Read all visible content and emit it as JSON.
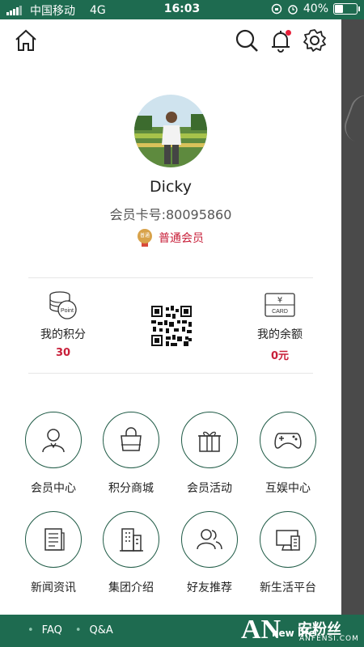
{
  "status_bar": {
    "carrier": "中国移动",
    "network": "4G",
    "time": "16:03",
    "battery": "40%",
    "battery_level": 0.4
  },
  "icons": {
    "home": "home-icon",
    "search": "search-icon",
    "bell": "bell-icon",
    "settings": "gear-icon"
  },
  "profile": {
    "name": "Dicky",
    "card_number": "会员卡号:80095860",
    "level": "普通会员",
    "medal_text": "普通"
  },
  "stats": {
    "points": {
      "label": "我的积分",
      "value": "30",
      "icon_text": "Point"
    },
    "balance": {
      "label": "我的余额",
      "value": "0元",
      "icon_text": "CARD",
      "currency": "¥"
    }
  },
  "menu": [
    {
      "label": "会员中心",
      "icon": "person-icon"
    },
    {
      "label": "积分商城",
      "icon": "shopping-bag-icon"
    },
    {
      "label": "会员活动",
      "icon": "gift-icon"
    },
    {
      "label": "互娱中心",
      "icon": "gamepad-icon"
    },
    {
      "label": "新闻资讯",
      "icon": "news-icon"
    },
    {
      "label": "集团介绍",
      "icon": "building-icon"
    },
    {
      "label": "好友推荐",
      "icon": "friends-icon"
    },
    {
      "label": "新生活平台",
      "icon": "platform-icon"
    }
  ],
  "footer": {
    "faq": "FAQ",
    "qa": "Q&A",
    "brand": "new life",
    "watermark": "安粉丝",
    "watermark_sub": "ANFENSI.COM",
    "watermark_logo": "AN"
  },
  "colors": {
    "brand_green": "#1e6b50",
    "accent_red": "#c8203a",
    "icon_stroke": "#1e5a45"
  }
}
